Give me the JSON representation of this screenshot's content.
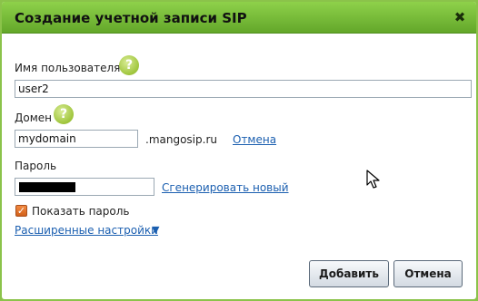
{
  "dialog": {
    "title": "Создание учетной записи SIP",
    "close_glyph": "✖"
  },
  "form": {
    "username": {
      "label": "Имя пользователя",
      "value": "user2",
      "help_glyph": "?"
    },
    "domain": {
      "label": "Домен",
      "value": "mydomain",
      "suffix": ".mangosip.ru",
      "cancel_link": "Отмена",
      "help_glyph": "?"
    },
    "password": {
      "label": "Пароль",
      "generate_link": "Сгенерировать новый"
    },
    "show_password": {
      "label": "Показать пароль",
      "checked": true,
      "check_glyph": "✓"
    },
    "advanced": {
      "label": "Расширенные настройки",
      "arrow": "▼"
    }
  },
  "buttons": {
    "add": "Добавить",
    "cancel": "Отмена"
  },
  "colors": {
    "titlebar": "#74b83a",
    "link": "#1b5fb0",
    "checkbox": "#e0712a"
  }
}
